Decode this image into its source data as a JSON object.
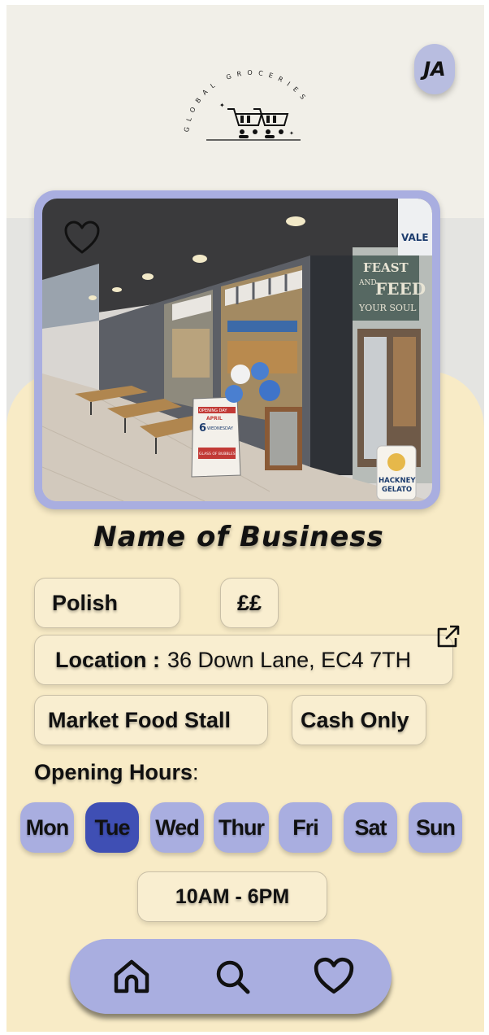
{
  "user": {
    "initials": "JA"
  },
  "logo": {
    "text": "GLOBAL GROCERIES"
  },
  "business": {
    "name": "Name of Business",
    "cuisine": "Polish",
    "price": "££",
    "location_label": "Location :",
    "location_value": "36 Down Lane, EC4 7TH",
    "type": "Market Food Stall",
    "payment": "Cash Only"
  },
  "hours": {
    "label": "Opening Hours",
    "label_suffix": ":",
    "days": [
      "Mon",
      "Tue",
      "Wed",
      "Thur",
      "Fri",
      "Sat",
      "Sun"
    ],
    "selected_day": "Tue",
    "selected_hours": "10AM - 6PM"
  },
  "photo_signage": {
    "shop_sign": [
      "FEAST",
      "AND",
      "FEED",
      "YOUR SOUL"
    ],
    "board": [
      "OPENING DAY",
      "APRIL",
      "6",
      "WEDNESDAY",
      "GLASS OF BUBBLES"
    ],
    "gelato": [
      "HACKNEY",
      "GELATO"
    ],
    "corner_sign": "VALE"
  },
  "nav": {
    "items": [
      {
        "id": "home",
        "icon": "home-icon"
      },
      {
        "id": "search",
        "icon": "search-icon"
      },
      {
        "id": "favorites",
        "icon": "heart-icon"
      }
    ]
  },
  "colors": {
    "accent": "#a9aee0",
    "active_day": "#3f4fb4",
    "cream": "#f8ebc6",
    "background": "#f1efe8"
  }
}
